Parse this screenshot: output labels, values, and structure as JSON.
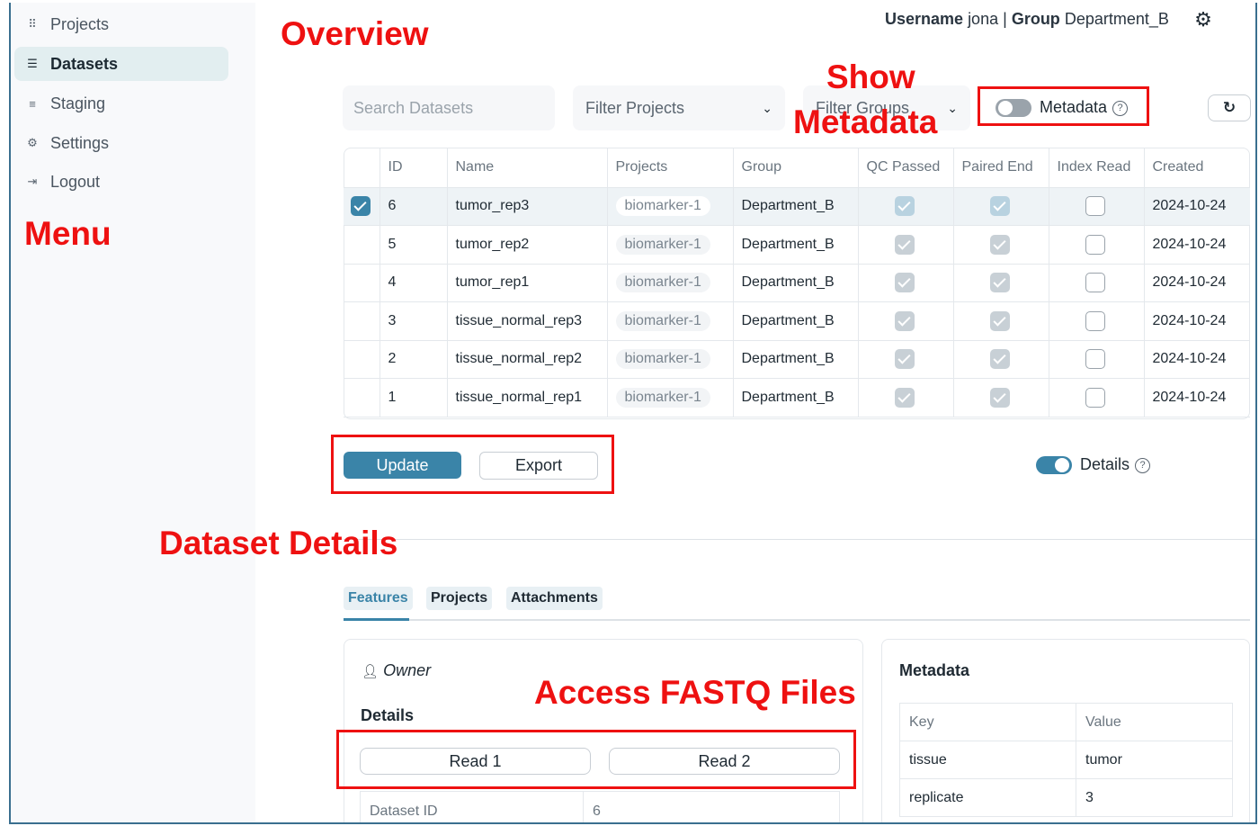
{
  "sidebar": {
    "items": [
      {
        "label": "Projects",
        "icon": "grid-icon"
      },
      {
        "label": "Datasets",
        "icon": "list-icon",
        "active": true
      },
      {
        "label": "Staging",
        "icon": "staging-icon"
      },
      {
        "label": "Settings",
        "icon": "gear-icon"
      },
      {
        "label": "Logout",
        "icon": "logout-icon"
      }
    ]
  },
  "header": {
    "username_label": "Username",
    "username": "jona",
    "separator": "|",
    "group_label": "Group",
    "group": "Department_B"
  },
  "annotations": {
    "overview": "Overview",
    "menu": "Menu",
    "show": "Show",
    "metadata": "Metadata",
    "dataset_details": "Dataset Details",
    "access_fastq": "Access FASTQ Files"
  },
  "filters": {
    "search_placeholder": "Search Datasets",
    "projects_placeholder": "Filter Projects",
    "groups_placeholder": "Filter Groups",
    "metadata_toggle_label": "Metadata",
    "metadata_toggle_on": false
  },
  "table": {
    "columns": [
      "ID",
      "Name",
      "Projects",
      "Group",
      "QC Passed",
      "Paired End",
      "Index Read",
      "Created"
    ],
    "rows": [
      {
        "selected": true,
        "id": "6",
        "name": "tumor_rep3",
        "project": "biomarker-1",
        "group": "Department_B",
        "qc": true,
        "paired": true,
        "index": false,
        "created": "2024-10-24"
      },
      {
        "selected": false,
        "id": "5",
        "name": "tumor_rep2",
        "project": "biomarker-1",
        "group": "Department_B",
        "qc": true,
        "paired": true,
        "index": false,
        "created": "2024-10-24"
      },
      {
        "selected": false,
        "id": "4",
        "name": "tumor_rep1",
        "project": "biomarker-1",
        "group": "Department_B",
        "qc": true,
        "paired": true,
        "index": false,
        "created": "2024-10-24"
      },
      {
        "selected": false,
        "id": "3",
        "name": "tissue_normal_rep3",
        "project": "biomarker-1",
        "group": "Department_B",
        "qc": true,
        "paired": true,
        "index": false,
        "created": "2024-10-24"
      },
      {
        "selected": false,
        "id": "2",
        "name": "tissue_normal_rep2",
        "project": "biomarker-1",
        "group": "Department_B",
        "qc": true,
        "paired": true,
        "index": false,
        "created": "2024-10-24"
      },
      {
        "selected": false,
        "id": "1",
        "name": "tissue_normal_rep1",
        "project": "biomarker-1",
        "group": "Department_B",
        "qc": true,
        "paired": true,
        "index": false,
        "created": "2024-10-24"
      }
    ]
  },
  "actions": {
    "update_label": "Update",
    "export_label": "Export",
    "details_toggle_label": "Details",
    "details_toggle_on": true
  },
  "details": {
    "tabs": [
      "Features",
      "Projects",
      "Attachments"
    ],
    "active_tab": "Features",
    "owner_label": "Owner",
    "details_heading": "Details",
    "read1_label": "Read 1",
    "read2_label": "Read 2",
    "dataset_id_label": "Dataset ID",
    "dataset_id_value": "6"
  },
  "metadata_card": {
    "title": "Metadata",
    "columns": [
      "Key",
      "Value"
    ],
    "rows": [
      {
        "key": "tissue",
        "value": "tumor"
      },
      {
        "key": "replicate",
        "value": "3"
      }
    ]
  },
  "colors": {
    "accent": "#3a84a8",
    "annotation_red": "#ee1111",
    "sidebar_active_bg": "#e2eef0"
  }
}
